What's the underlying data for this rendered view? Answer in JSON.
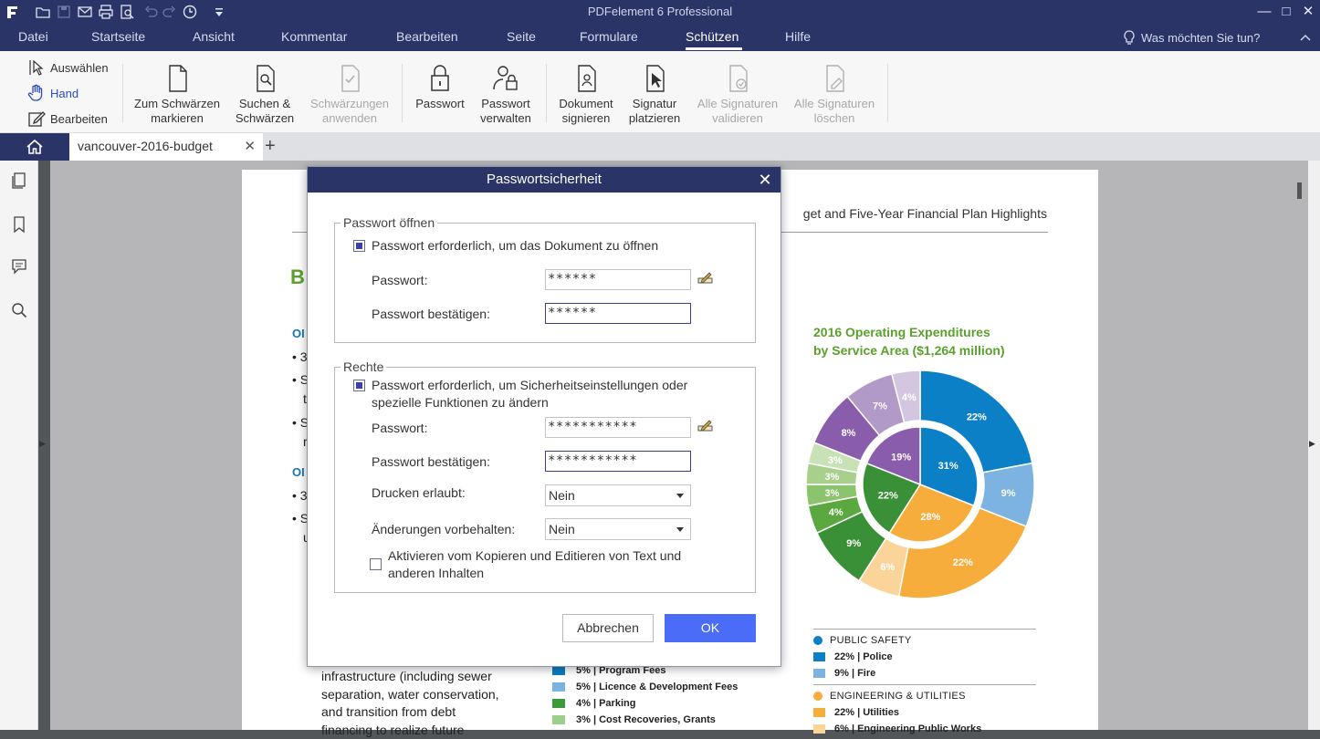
{
  "window": {
    "title": "PDFelement 6 Professional"
  },
  "menu": {
    "items": [
      "Datei",
      "Startseite",
      "Ansicht",
      "Kommentar",
      "Bearbeiten",
      "Seite",
      "Formulare",
      "Schützen",
      "Hilfe"
    ],
    "active": "Schützen",
    "help_search": "Was möchten Sie tun?"
  },
  "ribbon": {
    "select_label": "Auswählen",
    "hand_label": "Hand",
    "edit_label": "Bearbeiten",
    "redact_mark": "Zum Schwärzen\nmarkieren",
    "search_redact": "Suchen &\nSchwärzen",
    "apply_redactions": "Schwärzungen\nanwenden",
    "password": "Passwort",
    "manage_password": "Passwort\nverwalten",
    "sign_document": "Dokument\nsignieren",
    "place_signature": "Signatur\nplatzieren",
    "validate_all": "Alle Signaturen\nvalidieren",
    "delete_all": "Alle Signaturen\nlöschen"
  },
  "tabs": {
    "document": "vancouver-2016-budget"
  },
  "page": {
    "header": "get and Five-Year Financial Plan Highlights",
    "big_heading": "B",
    "sub1": "OI",
    "sub2": "OI",
    "bullets": [
      "• 3",
      "• S",
      "t",
      "• S",
      "r"
    ],
    "bullets2": [
      "• 3",
      "• S",
      "u"
    ],
    "paragraph": [
      "infrastructure (including sewer",
      "separation, water conservation,",
      "and transition from debt",
      "financing to realize future"
    ],
    "chart_title": [
      "2016 Operating Expenditures",
      "by Service Area ($1,264 million)"
    ],
    "legend": {
      "public_safety": "PUBLIC SAFETY",
      "police": "22% | Police",
      "fire": "9% | Fire",
      "eng_util": "ENGINEERING & UTILITIES",
      "utilities": "22% | Utilities",
      "eng_public": "6% | Engineering Public Works"
    },
    "bottom_legend": [
      {
        "label": "5% | Program Fees",
        "color": "#0a7fc5"
      },
      {
        "label": "5% | Licence & Development Fees",
        "color": "#7ab3e0"
      },
      {
        "label": "4% | Parking",
        "color": "#3b9b3b"
      },
      {
        "label": "3% | Cost Recoveries, Grants",
        "color": "#9ccf87"
      }
    ]
  },
  "chart_data": {
    "type": "pie",
    "title": "2016 Operating Expenditures by Service Area ($1,264 million)",
    "outer": [
      {
        "label": "22%",
        "value": 22,
        "color": "#0b80c6"
      },
      {
        "label": "9%",
        "value": 9,
        "color": "#7cb3e0"
      },
      {
        "label": "22%",
        "value": 22,
        "color": "#f6ad3c"
      },
      {
        "label": "6%",
        "value": 6,
        "color": "#fbd49a"
      },
      {
        "label": "9%",
        "value": 9,
        "color": "#3a9036"
      },
      {
        "label": "4%",
        "value": 4,
        "color": "#5aa83f"
      },
      {
        "label": "3%",
        "value": 3,
        "color": "#8cc36e"
      },
      {
        "label": "3%",
        "value": 3,
        "color": "#a8d08c"
      },
      {
        "label": "3%",
        "value": 3,
        "color": "#c9e1b7"
      },
      {
        "label": "8%",
        "value": 8,
        "color": "#8a5cac"
      },
      {
        "label": "7%",
        "value": 7,
        "color": "#b29ac8"
      },
      {
        "label": "4%",
        "value": 4,
        "color": "#d4c6e0"
      }
    ],
    "inner": [
      {
        "label": "31%",
        "value": 31,
        "color": "#0b80c6"
      },
      {
        "label": "28%",
        "value": 28,
        "color": "#f6ad3c"
      },
      {
        "label": "22%",
        "value": 22,
        "color": "#3a9036"
      },
      {
        "label": "19%",
        "value": 19,
        "color": "#8a5cac"
      }
    ]
  },
  "dialog": {
    "title": "Passwortsicherheit",
    "open_group": "Passwort öffnen",
    "open_checkbox": "Passwort erforderlich, um das Dokument zu öffnen",
    "password_label": "Passwort:",
    "confirm_label": "Passwort bestätigen:",
    "open_password": "******",
    "open_confirm": "******",
    "rights_group": "Rechte",
    "rights_checkbox_1": "Passwort erforderlich, um Sicherheitseinstellungen oder",
    "rights_checkbox_2": "spezielle Funktionen zu ändern",
    "rights_password": "***********",
    "rights_confirm": "***********",
    "print_label": "Drucken erlaubt:",
    "print_value": "Nein",
    "changes_label": "Änderungen vorbehalten:",
    "changes_value": "Nein",
    "copy_checkbox_1": "Aktivieren vom Kopieren und Editieren von Text und",
    "copy_checkbox_2": "anderen Inhalten",
    "cancel": "Abbrechen",
    "ok": "OK"
  }
}
